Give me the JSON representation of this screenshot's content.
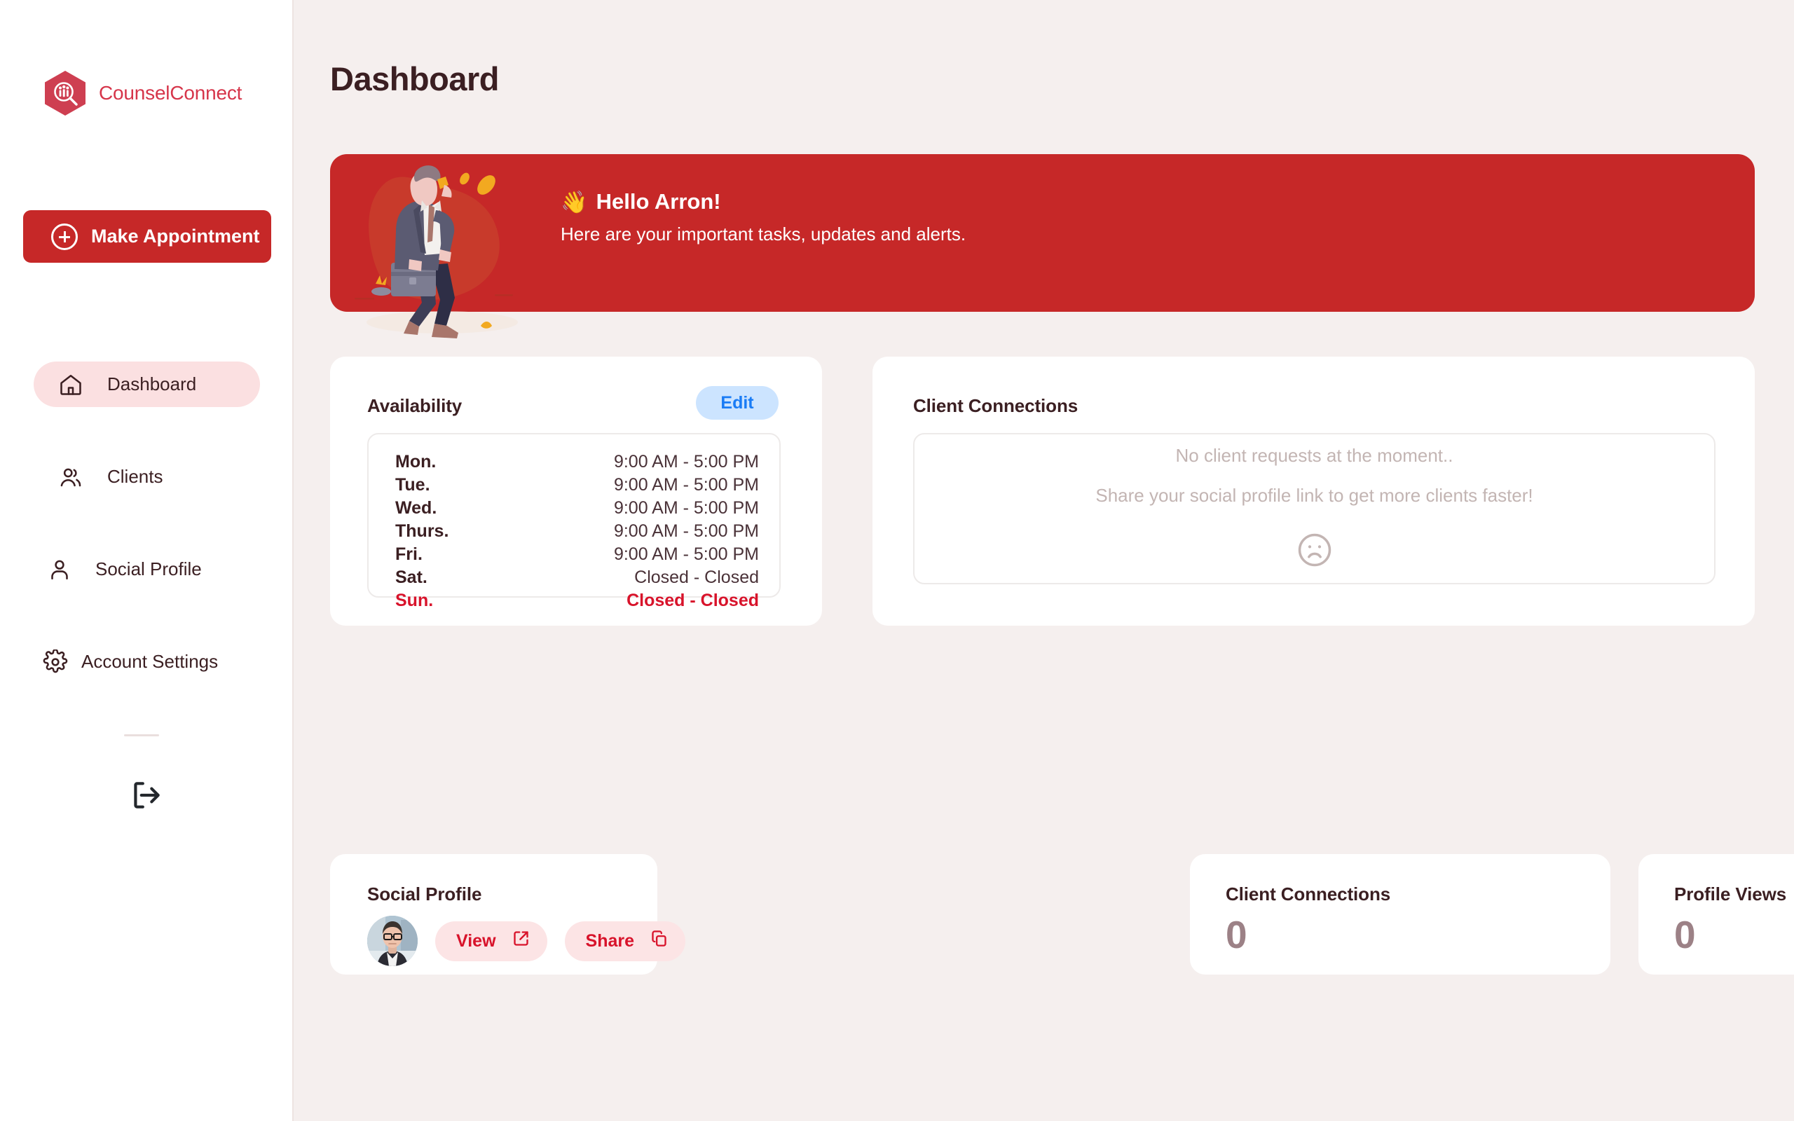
{
  "brand": {
    "name": "CounselConnect",
    "logo_icon": "hexagon-magnifier-people-icon",
    "accent_color": "#D6354A"
  },
  "sidebar": {
    "make_appointment_label": "Make Appointment",
    "make_appointment_icon": "plus-circle-icon",
    "items": [
      {
        "label": "Dashboard",
        "icon": "home-icon",
        "active": true
      },
      {
        "label": "Clients",
        "icon": "users-icon",
        "active": false
      },
      {
        "label": "Social Profile",
        "icon": "user-icon",
        "active": false
      },
      {
        "label": "Account Settings",
        "icon": "gear-icon",
        "active": false
      }
    ],
    "logout_icon": "logout-icon"
  },
  "header": {
    "title": "Dashboard"
  },
  "banner": {
    "wave_emoji": "👋",
    "greeting": "Hello Arron!",
    "subtitle": "Here are your important tasks, updates and alerts.",
    "background_color": "#C62828",
    "illustration": "businessman-walking-with-briefcase-on-phone"
  },
  "availability": {
    "title": "Availability",
    "edit_label": "Edit",
    "edit_text_color": "#1A7CF5",
    "edit_bg_color": "#CCE4FF",
    "rows": [
      {
        "day": "Mon.",
        "hours": "9:00 AM - 5:00 PM",
        "closed": false
      },
      {
        "day": "Tue.",
        "hours": "9:00 AM - 5:00 PM",
        "closed": false
      },
      {
        "day": "Wed.",
        "hours": "9:00 AM - 5:00 PM",
        "closed": false
      },
      {
        "day": "Thurs.",
        "hours": "9:00 AM - 5:00 PM",
        "closed": false
      },
      {
        "day": "Fri.",
        "hours": "9:00 AM - 5:00 PM",
        "closed": false
      },
      {
        "day": "Sat.",
        "hours": "Closed - Closed",
        "closed": false
      },
      {
        "day": "Sun.",
        "hours": "Closed - Closed",
        "closed": true
      }
    ]
  },
  "client_connections_panel": {
    "title": "Client Connections",
    "empty_line_1": "No client requests at the moment..",
    "empty_line_2": "Share your social profile link to get more clients faster!",
    "empty_icon": "sad-face-icon"
  },
  "social_profile_card": {
    "title": "Social Profile",
    "avatar": "user-avatar-photo",
    "view_label": "View",
    "view_icon": "external-link-icon",
    "share_label": "Share",
    "share_icon": "copy-icon",
    "accent_color": "#D8132B"
  },
  "stat_cards": [
    {
      "title": "Client Connections",
      "value": "0"
    },
    {
      "title": "Profile Views",
      "value": "0"
    }
  ]
}
